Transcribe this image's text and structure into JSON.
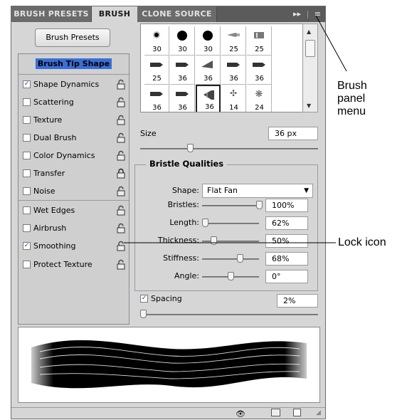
{
  "tabs": [
    {
      "label": "BRUSH PRESETS",
      "active": false
    },
    {
      "label": "BRUSH",
      "active": true
    },
    {
      "label": "CLONE SOURCE",
      "active": false
    }
  ],
  "tab_icons": {
    "collapse": "▸▸",
    "menu": "≡"
  },
  "brush_presets_button": "Brush Presets",
  "left_list": {
    "heading": "Brush Tip Shape",
    "items": [
      {
        "label": "Shape Dynamics",
        "checked": true
      },
      {
        "label": "Scattering",
        "checked": false
      },
      {
        "label": "Texture",
        "checked": false
      },
      {
        "label": "Dual Brush",
        "checked": false
      },
      {
        "label": "Color Dynamics",
        "checked": false
      },
      {
        "label": "Transfer",
        "checked": false
      },
      {
        "label": "Noise",
        "checked": false
      },
      {
        "label": "Wet Edges",
        "checked": false
      },
      {
        "label": "Airbrush",
        "checked": false
      },
      {
        "label": "Smoothing",
        "checked": true
      },
      {
        "label": "Protect Texture",
        "checked": false
      }
    ],
    "check_mark": "✓"
  },
  "brush_tips": [
    {
      "size": "30",
      "icon": "soft-round-small"
    },
    {
      "size": "30",
      "icon": "hard-round"
    },
    {
      "size": "30",
      "icon": "hard-round"
    },
    {
      "size": "25",
      "icon": "bristle-point"
    },
    {
      "size": "25",
      "icon": "bristle-flat"
    },
    {
      "size": "25",
      "icon": "bristle-flat-point"
    },
    {
      "size": "36",
      "icon": "bristle-angle"
    },
    {
      "size": "36",
      "icon": "bristle-fan"
    },
    {
      "size": "36",
      "icon": "bristle-round-blunt"
    },
    {
      "size": "36",
      "icon": "bristle-flat-blunt"
    },
    {
      "size": "36",
      "icon": "bristle-round-point"
    },
    {
      "size": "36",
      "icon": "bristle-round-angle"
    },
    {
      "size": "36",
      "icon": "bristle-flat-fan",
      "selected": true
    },
    {
      "size": "14",
      "icon": "scatter-leaf"
    },
    {
      "size": "24",
      "icon": "scatter-star"
    }
  ],
  "size": {
    "label": "Size",
    "value": "36 px",
    "slider_fraction": 0.28
  },
  "bristle": {
    "title": "Bristle Qualities",
    "shape_label": "Shape:",
    "shape_value": "Flat Fan",
    "rows": [
      {
        "label": "Bristles:",
        "value": "100%",
        "fraction": 1.0
      },
      {
        "label": "Length:",
        "value": "62%",
        "fraction": 0.05
      },
      {
        "label": "Thickness:",
        "value": "50%",
        "fraction": 0.2
      },
      {
        "label": "Stiffness:",
        "value": "68%",
        "fraction": 0.66
      },
      {
        "label": "Angle:",
        "value": "0°",
        "fraction": 0.5
      }
    ]
  },
  "spacing": {
    "label": "Spacing",
    "value": "2%",
    "checked": true,
    "slider_fraction": 0.0
  },
  "footer_icons": [
    "eye-brush-icon",
    "grid-icon",
    "new-preset-icon"
  ],
  "callouts": {
    "brush_panel_menu": [
      "Brush",
      "panel",
      "menu"
    ],
    "lock_icon": "Lock icon"
  }
}
